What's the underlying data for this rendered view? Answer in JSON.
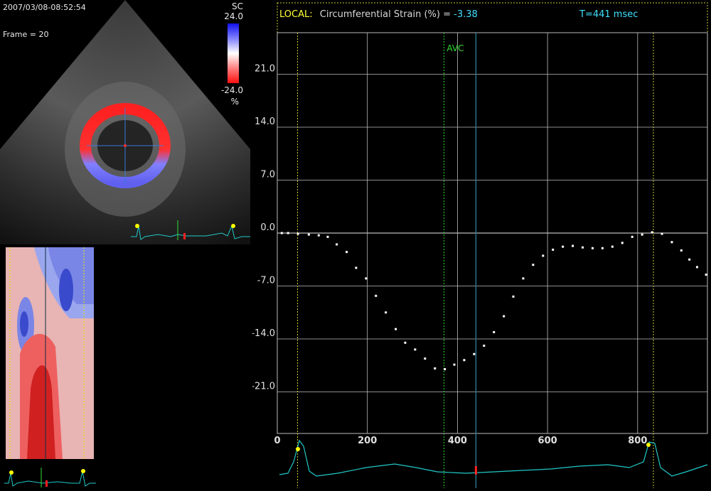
{
  "echo": {
    "timestamp": "2007/03/08-08:52:54",
    "frame_label": "Frame = 20",
    "scale_title": "SC",
    "scale_max": "24.0",
    "scale_min": "-24.0",
    "scale_unit": "%"
  },
  "header": {
    "local_label": "LOCAL:",
    "measure": "Circumferential Strain (%) =",
    "value": "-3.38",
    "time": "T=441 msec"
  },
  "markers": {
    "avc_label": "AVC"
  },
  "colors": {
    "local": "#ffff33",
    "measure": "#d8d8d8",
    "value": "#40e0ff",
    "avc": "#33dd33",
    "ecg": "#20c8c8",
    "cursor": "#ff2020",
    "grid": "#bdbdbd"
  },
  "chart_data": {
    "type": "scatter",
    "title": "",
    "xlabel": "",
    "ylabel": "",
    "xlim": [
      0,
      955
    ],
    "ylim": [
      -26.5,
      26.5
    ],
    "x_ticks": [
      0,
      200,
      400,
      600,
      800
    ],
    "y_ticks": [
      21.0,
      14.0,
      7.0,
      0.0,
      -7.0,
      -14.0,
      -21.0
    ],
    "grid": true,
    "reference_lines": {
      "ed_left": 45,
      "ed_right": 835,
      "avc": 370,
      "cursor": 441
    },
    "series": [
      {
        "x": [
          10,
          24,
          46,
          70,
          92,
          112,
          132,
          154,
          175,
          197,
          219,
          241,
          263,
          284,
          306,
          328,
          350,
          372,
          393,
          415,
          437,
          459,
          481,
          503,
          524,
          546,
          568,
          590,
          612,
          634,
          656,
          678,
          700,
          722,
          744,
          766,
          788,
          810,
          832,
          854,
          876,
          897,
          915,
          932,
          952
        ],
        "y": [
          0.0,
          0.0,
          -0.1,
          -0.2,
          -0.3,
          -0.5,
          -1.5,
          -2.5,
          -4.6,
          -6.0,
          -8.3,
          -10.5,
          -12.7,
          -14.5,
          -15.4,
          -16.6,
          -17.9,
          -18.0,
          -17.4,
          -16.8,
          -16.0,
          -14.9,
          -13.1,
          -11.0,
          -8.4,
          -6.0,
          -4.2,
          -3.0,
          -2.2,
          -1.8,
          -1.7,
          -1.9,
          -2.0,
          -2.0,
          -1.8,
          -1.3,
          -0.5,
          -0.2,
          0.1,
          -0.1,
          -1.2,
          -2.3,
          -3.5,
          -4.5,
          -5.5
        ]
      }
    ]
  }
}
